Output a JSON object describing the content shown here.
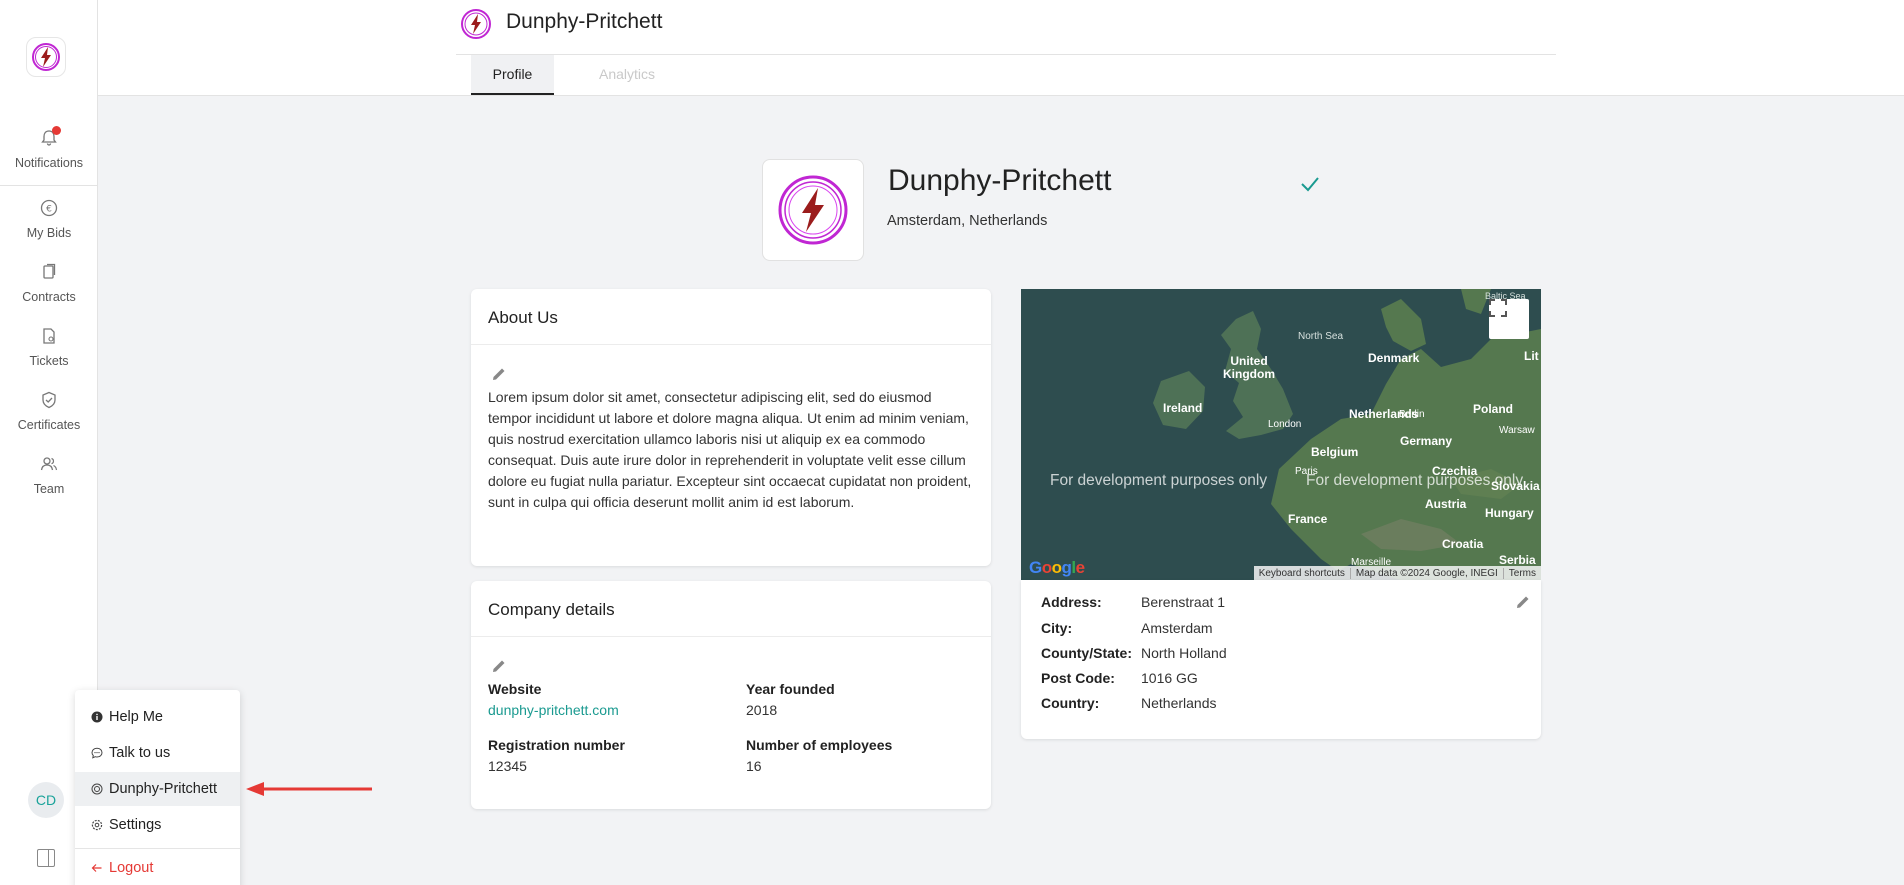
{
  "sidebar": {
    "items": [
      {
        "label": "Notifications",
        "icon": "bell-icon"
      },
      {
        "label": "My Bids",
        "icon": "euro-icon"
      },
      {
        "label": "Contracts",
        "icon": "contract-icon"
      },
      {
        "label": "Tickets",
        "icon": "ticket-icon"
      },
      {
        "label": "Certificates",
        "icon": "shield-check-icon"
      },
      {
        "label": "Team",
        "icon": "team-icon"
      }
    ],
    "avatar_initials": "CD"
  },
  "header": {
    "title": "Dunphy-Pritchett",
    "tabs": [
      {
        "label": "Profile",
        "active": true
      },
      {
        "label": "Analytics",
        "active": false
      }
    ]
  },
  "profile": {
    "name": "Dunphy-Pritchett",
    "location": "Amsterdam, Netherlands",
    "verified": true
  },
  "about": {
    "title": "About Us",
    "text": "Lorem ipsum dolor sit amet, consectetur adipiscing elit, sed do eiusmod tempor incididunt ut labore et dolore magna aliqua. Ut enim ad minim veniam, quis nostrud exercitation ullamco laboris nisi ut aliquip ex ea commodo consequat. Duis aute irure dolor in reprehenderit in voluptate velit esse cillum dolore eu fugiat nulla pariatur. Excepteur sint occaecat cupidatat non proident, sunt in culpa qui officia deserunt mollit anim id est laborum."
  },
  "company_details": {
    "title": "Company details",
    "website_label": "Website",
    "website": "dunphy-pritchett.com",
    "year_label": "Year founded",
    "year": "2018",
    "reg_label": "Registration number",
    "reg": "12345",
    "emp_label": "Number of employees",
    "emp": "16"
  },
  "map": {
    "labels": {
      "north_sea": "North Sea",
      "united": "United",
      "kingdom": "Kingdom",
      "ireland": "Ireland",
      "london": "London",
      "denmark": "Denmark",
      "netherlands": "Netherlands",
      "berlin": "Berlin",
      "poland": "Poland",
      "warsaw": "Warsaw",
      "germany": "Germany",
      "belgium": "Belgium",
      "paris": "Paris",
      "czechia": "Czechia",
      "slovakia": "Slovakia",
      "austria": "Austria",
      "hungary": "Hungary",
      "france": "France",
      "croatia": "Croatia",
      "serbia": "Serbia",
      "marseille": "Marseille",
      "lit": "Lit",
      "baltic": "Baltic Sea"
    },
    "dev_text": "For development purposes only",
    "footer": {
      "shortcuts": "Keyboard shortcuts",
      "data": "Map data ©2024 Google, INEGI",
      "terms": "Terms"
    },
    "google": "Google"
  },
  "address": {
    "address_label": "Address:",
    "address": "Berenstraat 1",
    "city_label": "City:",
    "city": "Amsterdam",
    "county_label": "County/State:",
    "county": "North Holland",
    "post_label": "Post Code:",
    "post": "1016 GG",
    "country_label": "Country:",
    "country": "Netherlands"
  },
  "menu": {
    "items": [
      {
        "label": "Help Me",
        "icon": "info-icon"
      },
      {
        "label": "Talk to us",
        "icon": "chat-icon"
      },
      {
        "label": "Dunphy-Pritchett",
        "icon": "company-icon",
        "active": true
      },
      {
        "label": "Settings",
        "icon": "gear-icon"
      }
    ],
    "logout": "Logout"
  },
  "colors": {
    "accent": "#1a9a90",
    "danger": "#e53935",
    "brand_magenta": "#c026d3",
    "brand_red": "#9b1c1c"
  }
}
